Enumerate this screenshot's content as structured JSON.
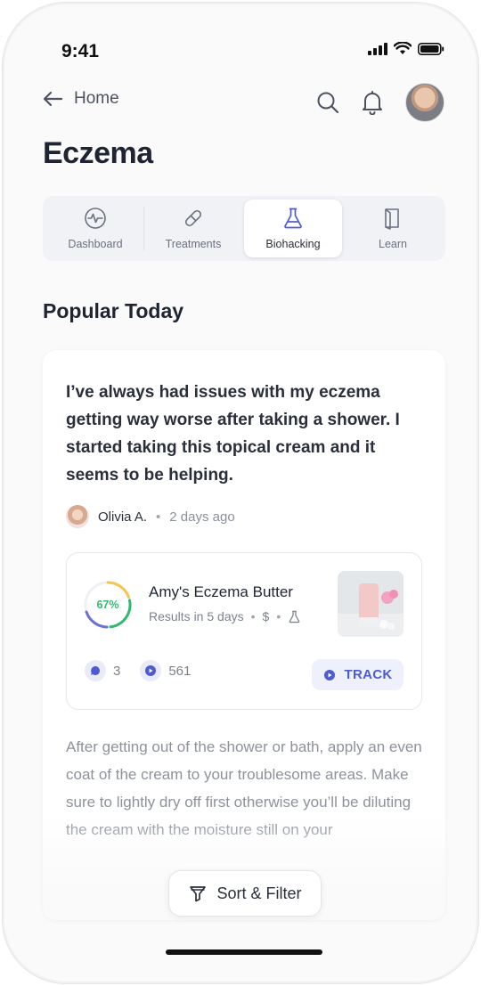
{
  "status": {
    "time": "9:41"
  },
  "nav": {
    "back_label": "Home"
  },
  "page": {
    "title": "Eczema"
  },
  "tabs": [
    {
      "label": "Dashboard",
      "icon": "activity-icon",
      "active": false
    },
    {
      "label": "Treatments",
      "icon": "pill-icon",
      "active": false
    },
    {
      "label": "Biohacking",
      "icon": "flask-icon",
      "active": true
    },
    {
      "label": "Learn",
      "icon": "book-icon",
      "active": false
    }
  ],
  "section": {
    "title": "Popular Today"
  },
  "post": {
    "quote": "I’ve always had issues with my eczema getting way worse after taking a shower. I started taking this topical cream and it seems to be helping.",
    "author": "Olivia A.",
    "time_ago": "2 days ago",
    "separator": "•",
    "product": {
      "name": "Amy's Eczema Butter",
      "success_rate": 0.67,
      "success_label": "67%",
      "results": "Results in 5 days",
      "price": "$",
      "comments": "3",
      "views": "561",
      "track_label": "TRACK"
    },
    "body": "After getting out of the shower or bath, apply an even coat of the cream to your troublesome areas. Make sure to lightly dry off first otherwise you’ll be diluting the cream with the moisture still on your"
  },
  "footer": {
    "sort_label": "Sort & Filter"
  },
  "colors": {
    "accent": "#4d5bd1",
    "success": "#34b870",
    "ring_warn": "#f5c451"
  }
}
